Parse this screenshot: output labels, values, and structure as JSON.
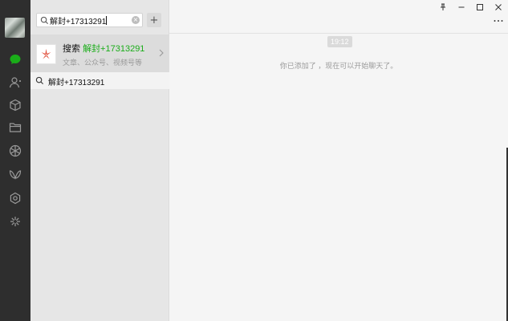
{
  "search": {
    "query": "解封+17313291",
    "clear_glyph": "×",
    "add_glyph": "+"
  },
  "result": {
    "prefix": "搜索",
    "highlight": "解封+17313291",
    "subtitle": "文章、公众号、视频号等"
  },
  "query_row": {
    "text": "解封+17313291"
  },
  "chat": {
    "time": "19:12",
    "system_message": "你已添加了 ，现在可以开始聊天了。"
  },
  "rail": {
    "icons": [
      "chat-icon",
      "contacts-icon",
      "favorites-icon",
      "files-icon",
      "moments-icon",
      "channels-icon",
      "mini-programs-icon",
      "settings-icon"
    ]
  },
  "colors": {
    "accent": "#1aad19",
    "rail_bg": "#2e2e2e",
    "list_bg": "#e6e6e6",
    "chat_bg": "#f5f5f5"
  }
}
